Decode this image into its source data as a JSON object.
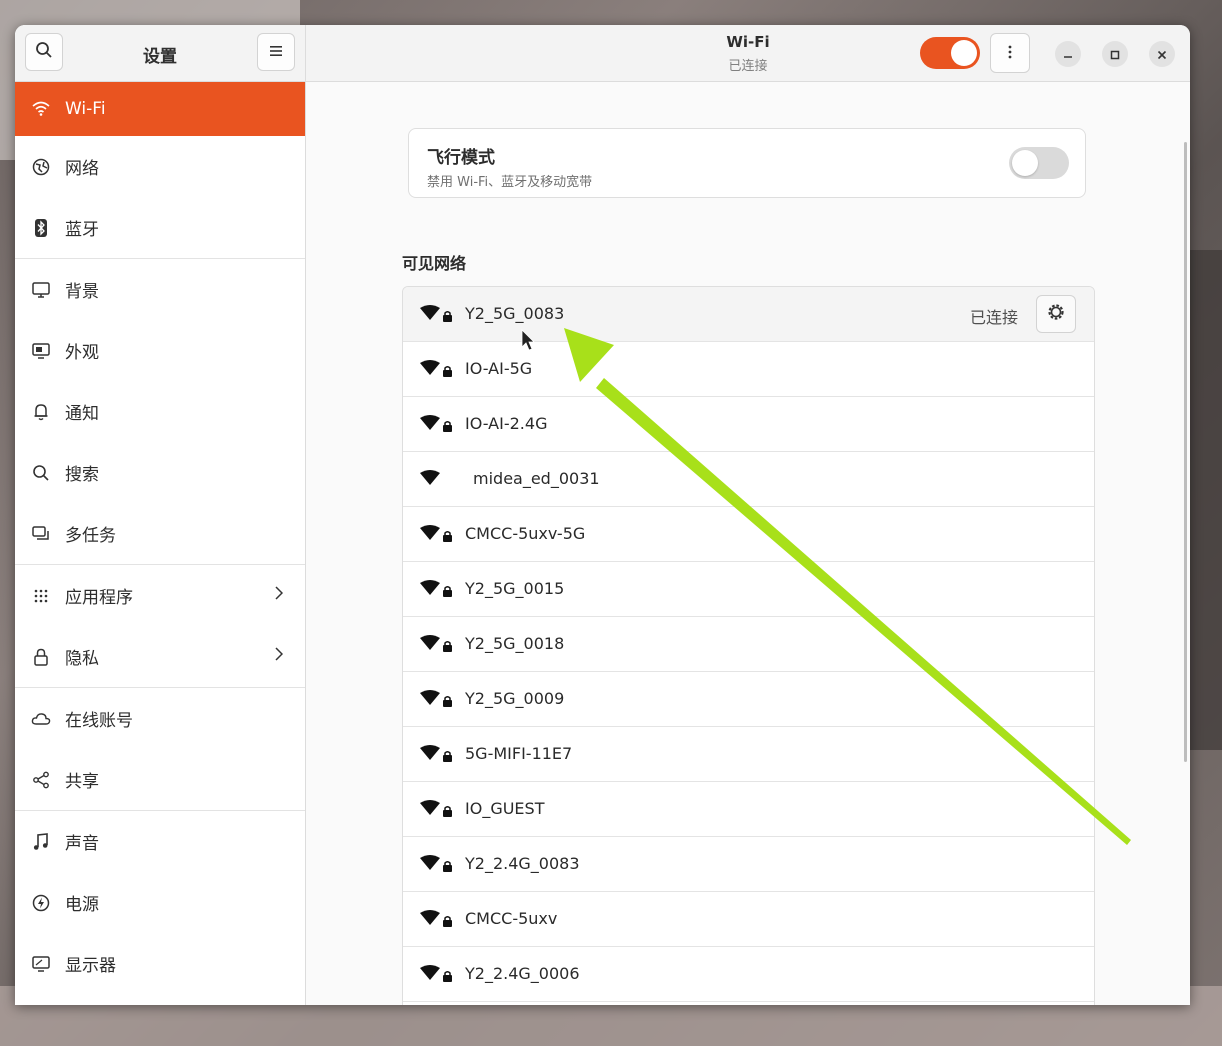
{
  "sidebar": {
    "title": "设置",
    "items": [
      {
        "label": "Wi-Fi",
        "icon": "wifi-icon",
        "active": true
      },
      {
        "label": "网络",
        "icon": "network-globe-icon"
      },
      {
        "label": "蓝牙",
        "icon": "bluetooth-icon"
      },
      {
        "label": "背景",
        "icon": "background-display-icon"
      },
      {
        "label": "外观",
        "icon": "appearance-icon"
      },
      {
        "label": "通知",
        "icon": "bell-icon"
      },
      {
        "label": "搜索",
        "icon": "search-icon"
      },
      {
        "label": "多任务",
        "icon": "multitask-icon"
      },
      {
        "label": "应用程序",
        "icon": "apps-grid-icon",
        "chevron": true
      },
      {
        "label": "隐私",
        "icon": "lock-icon",
        "chevron": true
      },
      {
        "label": "在线账号",
        "icon": "cloud-icon"
      },
      {
        "label": "共享",
        "icon": "share-icon"
      },
      {
        "label": "声音",
        "icon": "music-note-icon"
      },
      {
        "label": "电源",
        "icon": "power-icon"
      },
      {
        "label": "显示器",
        "icon": "monitor-icon"
      }
    ]
  },
  "header": {
    "title": "Wi-Fi",
    "subtitle": "已连接",
    "wifi_enabled": true
  },
  "airplane": {
    "title": "飞行模式",
    "subtitle": "禁用 Wi-Fi、蓝牙及移动宽带",
    "enabled": false
  },
  "networks": {
    "section_title": "可见网络",
    "items": [
      {
        "name": "Y2_5G_0083",
        "secured": true,
        "status": "已连接"
      },
      {
        "name": "IO-AI-5G",
        "secured": true
      },
      {
        "name": "IO-AI-2.4G",
        "secured": true
      },
      {
        "name": "midea_ed_0031",
        "secured": false
      },
      {
        "name": "CMCC-5uxv-5G",
        "secured": true
      },
      {
        "name": "Y2_5G_0015",
        "secured": true
      },
      {
        "name": "Y2_5G_0018",
        "secured": true
      },
      {
        "name": "Y2_5G_0009",
        "secured": true
      },
      {
        "name": "5G-MIFI-11E7",
        "secured": true
      },
      {
        "name": "IO_GUEST",
        "secured": true
      },
      {
        "name": "Y2_2.4G_0083",
        "secured": true
      },
      {
        "name": "CMCC-5uxv",
        "secured": true
      },
      {
        "name": "Y2_2.4G_0006",
        "secured": true
      }
    ]
  },
  "colors": {
    "accent": "#e95420",
    "annotation_arrow": "#a8e01a"
  }
}
